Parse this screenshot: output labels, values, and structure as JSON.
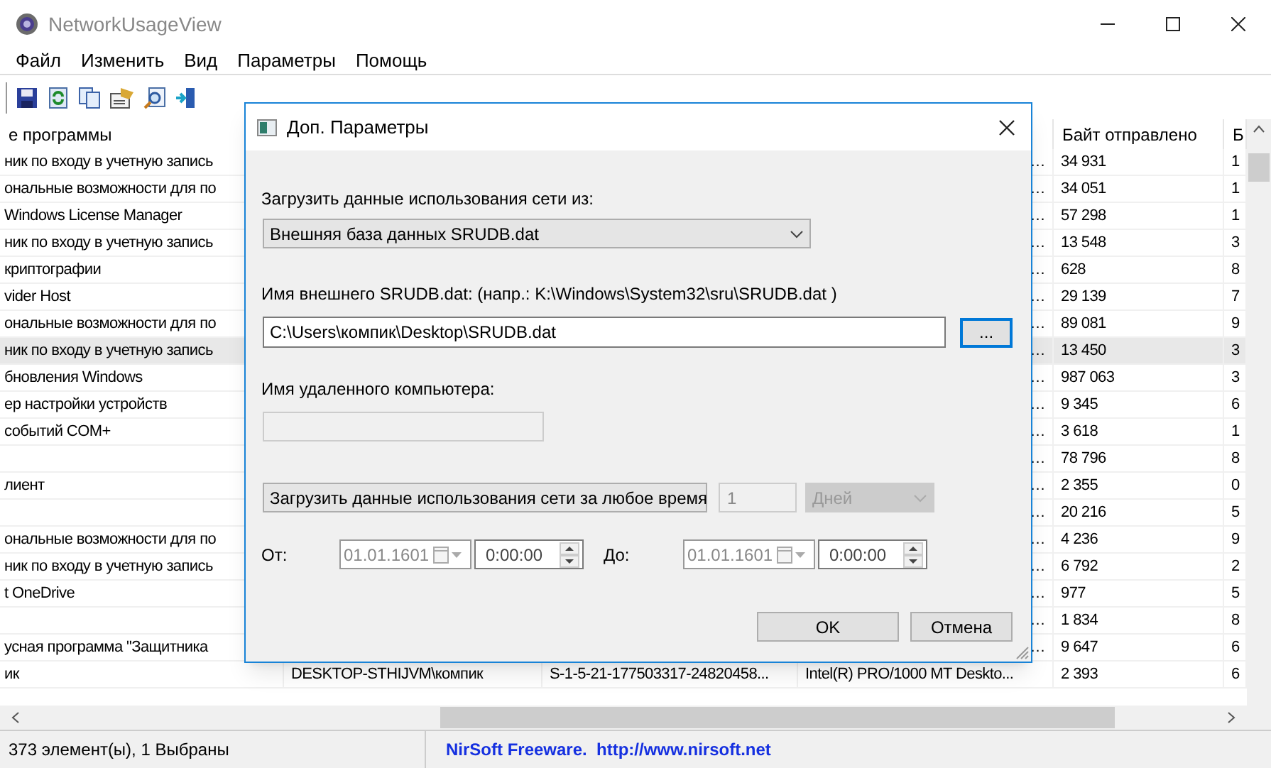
{
  "window": {
    "title": "NetworkUsageView"
  },
  "menu": [
    "Файл",
    "Изменить",
    "Вид",
    "Параметры",
    "Помощь"
  ],
  "table": {
    "columns": [
      {
        "label": "е программы"
      },
      {},
      {},
      {},
      {
        "label": "Байт отправлено"
      },
      {
        "label": "Б"
      }
    ],
    "rows": [
      {
        "col_1": "ник по входу в учетную запись",
        "col_4": "…",
        "bytes_sent": "34 931",
        "col_6": "1",
        "selected": false
      },
      {
        "col_1": "ональные возможности для по",
        "col_4": "…",
        "bytes_sent": "34 051",
        "col_6": "1",
        "selected": false
      },
      {
        "col_1": "Windows License Manager",
        "col_4": "…",
        "bytes_sent": "57 298",
        "col_6": "1",
        "selected": false
      },
      {
        "col_1": "ник по входу в учетную запись",
        "col_4": "…",
        "bytes_sent": "13 548",
        "col_6": "3",
        "selected": false
      },
      {
        "col_1": "криптографии",
        "col_4": "…",
        "bytes_sent": "628",
        "col_6": "8",
        "selected": false
      },
      {
        "col_1": "vider Host",
        "col_4": "…",
        "bytes_sent": "29 139",
        "col_6": "7",
        "selected": false
      },
      {
        "col_1": "ональные возможности для по",
        "col_4": "…",
        "bytes_sent": "89 081",
        "col_6": "9",
        "selected": false
      },
      {
        "col_1": "ник по входу в учетную запись",
        "col_4": "…",
        "bytes_sent": "13 450",
        "col_6": "3",
        "selected": true
      },
      {
        "col_1": "бновления Windows",
        "col_4": "…",
        "bytes_sent": "987 063",
        "col_6": "3",
        "selected": false
      },
      {
        "col_1": "ер настройки устройств",
        "col_4": "…",
        "bytes_sent": "9 345",
        "col_6": "6",
        "selected": false
      },
      {
        "col_1": "событий COM+",
        "col_4": "…",
        "bytes_sent": "3 618",
        "col_6": "1",
        "selected": false
      },
      {
        "col_4": "…",
        "bytes_sent": "78 796",
        "col_6": "8",
        "selected": false
      },
      {
        "col_1": "лиент",
        "col_4": "…",
        "bytes_sent": "2 355",
        "col_6": "0",
        "selected": false
      },
      {
        "col_4": "…",
        "bytes_sent": "20 216",
        "col_6": "5",
        "selected": false
      },
      {
        "col_1": "ональные возможности для по",
        "col_4": "…",
        "bytes_sent": "4 236",
        "col_6": "9",
        "selected": false
      },
      {
        "col_1": "ник по входу в учетную запись",
        "col_4": "…",
        "bytes_sent": "6 792",
        "col_6": "2",
        "selected": false
      },
      {
        "col_1": "t OneDrive",
        "col_4": "…",
        "bytes_sent": "977",
        "col_6": "5",
        "selected": false
      },
      {
        "col_4": "…",
        "bytes_sent": "1 834",
        "col_6": "8",
        "selected": false
      },
      {
        "col_1": "усная программа \"Защитника",
        "col_4": "…",
        "bytes_sent": "9 647",
        "col_6": "6",
        "selected": false
      },
      {
        "col_1": "ик",
        "col_2": "DESKTOP-STHIJVM\\компик",
        "col_3": "S-1-5-21-177503317-24820458...",
        "col_4": "Intel(R) PRO/1000 MT Deskto...",
        "bytes_sent": "2 393",
        "col_6": "6",
        "selected": false
      }
    ]
  },
  "status_bar": {
    "count": "373 элемент(ы), 1 Выбраны",
    "link": "NirSoft Freeware.  http://www.nirsoft.net"
  },
  "dialog": {
    "title": "Доп. Параметры",
    "source_label": "Загрузить данные использования сети из:",
    "source": "Внешняя база данных SRUDB.dat",
    "path_label": "Имя внешнего SRUDB.dat: (напр.: K:\\Windows\\System32\\sru\\SRUDB.dat )",
    "path": "C:\\Users\\компик\\Desktop\\SRUDB.dat",
    "browse": "...",
    "remote_label": "Имя удаленного компьютера:",
    "remote_disabled": true,
    "range": "Загрузить данные использования сети за любое время",
    "amount": "1",
    "unit": "Дней",
    "amount_disabled": true,
    "from_label": "От:",
    "from_date": "01.01.1601",
    "from_time": "0:00:00",
    "to_label": "До:",
    "to_date": "01.01.1601",
    "to_time": "0:00:00",
    "dates_disabled": true,
    "buttons": [
      "OK",
      "Отмена"
    ]
  }
}
